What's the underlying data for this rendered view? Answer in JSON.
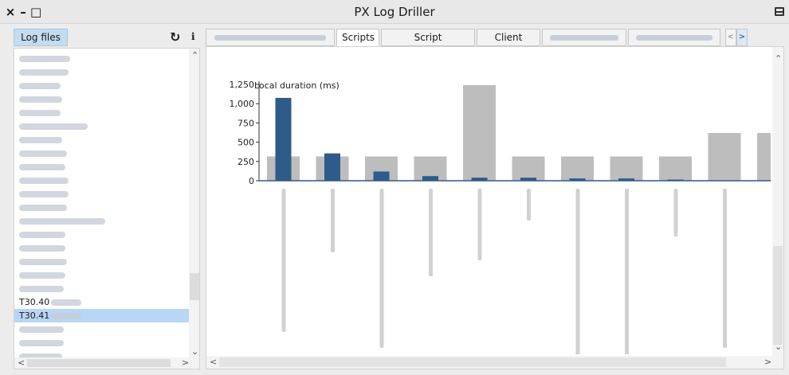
{
  "window": {
    "title": "PX Log Driller",
    "controls": {
      "close": "×",
      "minimize": "–",
      "maximize": "□"
    }
  },
  "left_panel": {
    "tab_label": "Log files",
    "refresh_icon": "↻",
    "info_icon": "i",
    "files": [
      {
        "label": "",
        "selected": false
      },
      {
        "label": "",
        "selected": false
      },
      {
        "label": "",
        "selected": false
      },
      {
        "label": "",
        "selected": false
      },
      {
        "label": "",
        "selected": false
      },
      {
        "label": "",
        "selected": false
      },
      {
        "label": "",
        "selected": false
      },
      {
        "label": "",
        "selected": false
      },
      {
        "label": "",
        "selected": false
      },
      {
        "label": "",
        "selected": false
      },
      {
        "label": "",
        "selected": false
      },
      {
        "label": "",
        "selected": false
      },
      {
        "label": "",
        "selected": false
      },
      {
        "label": "",
        "selected": false
      },
      {
        "label": "",
        "selected": false
      },
      {
        "label": "",
        "selected": false
      },
      {
        "label": "",
        "selected": false
      },
      {
        "label": "",
        "selected": false
      },
      {
        "label": "T30.40",
        "selected": false
      },
      {
        "label": "T30.41",
        "selected": true
      },
      {
        "label": "",
        "selected": false
      },
      {
        "label": "",
        "selected": false
      },
      {
        "label": "",
        "selected": false
      }
    ]
  },
  "tabs": [
    {
      "label": "",
      "active": false,
      "blurred": true
    },
    {
      "label": "Scripts",
      "active": true,
      "blurred": false
    },
    {
      "label": "Script activations",
      "active": false,
      "blurred": false
    },
    {
      "label": "Client SQLs",
      "active": false,
      "blurred": false
    },
    {
      "label": "",
      "active": false,
      "blurred": true
    },
    {
      "label": "",
      "active": false,
      "blurred": true
    }
  ],
  "colors": {
    "bar_primary": "#2e5b8a",
    "bar_secondary": "#bdbdbd",
    "selected_row": "#b8d6f5",
    "tab_highlight": "#c5dcf0"
  },
  "chart_data": {
    "type": "bar",
    "ylabel": "Local duration (ms)",
    "ylim": [
      0,
      1250
    ],
    "yticks": [
      0,
      250,
      500,
      750,
      1000,
      1250
    ],
    "categories": [
      "",
      "",
      "",
      "",
      "",
      "",
      "",
      "",
      "",
      "",
      ""
    ],
    "series": [
      {
        "values": [
          315,
          315,
          315,
          315,
          1240,
          315,
          315,
          315,
          315,
          620,
          620
        ]
      },
      {
        "values": [
          1075,
          355,
          120,
          60,
          40,
          40,
          30,
          30,
          15,
          0,
          0
        ]
      }
    ],
    "grid": false
  }
}
